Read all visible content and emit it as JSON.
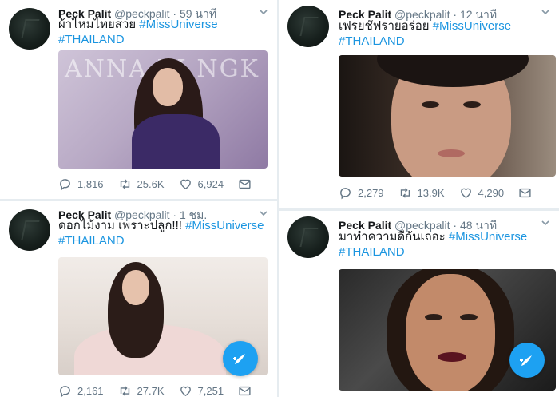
{
  "colors": {
    "accent": "#1da1f2",
    "hashtag": "#1b95e0",
    "muted": "#657786",
    "background": "#e6ecf0"
  },
  "tweets": [
    {
      "name": "Peck Palit",
      "handle": "@peckpalit",
      "separator": "·",
      "time": "59 นาที",
      "text": "ผ้าไหมไทยสวย",
      "hashtag1": "#MissUniverse",
      "hashtag2": "#THAILAND",
      "media_overlay_text": "ANNA RI   NGK",
      "replies": "1,816",
      "retweets": "25.6K",
      "likes": "6,924"
    },
    {
      "name": "Peck Palit",
      "handle": "@peckpalit",
      "separator": "·",
      "time": "12 นาที",
      "text": "เฟรยชัฟรายอร่อย",
      "hashtag1": "#MissUniverse",
      "hashtag2": "#THAILAND",
      "replies": "2,279",
      "retweets": "13.9K",
      "likes": "4,290"
    },
    {
      "name": "Peck Palit",
      "handle": "@peckpalit",
      "separator": "·",
      "time": "1 ชม.",
      "text": "ดอกไม้งาม เพราะปลูก!!!",
      "hashtag1": "#MissUniverse",
      "hashtag2": "#THAILAND",
      "replies": "2,161",
      "retweets": "27.7K",
      "likes": "7,251"
    },
    {
      "name": "Peck Palit",
      "handle": "@peckpalit",
      "separator": "·",
      "time": "48 นาที",
      "text": "มาทำความดีกันเถอะ",
      "hashtag1": "#MissUniverse",
      "hashtag2": "#THAILAND",
      "replies": "",
      "retweets": "",
      "likes": ""
    }
  ],
  "icons": [
    "reply-icon",
    "retweet-icon",
    "like-icon",
    "direct-message-icon",
    "caret-down-icon",
    "compose-tweet-icon"
  ]
}
